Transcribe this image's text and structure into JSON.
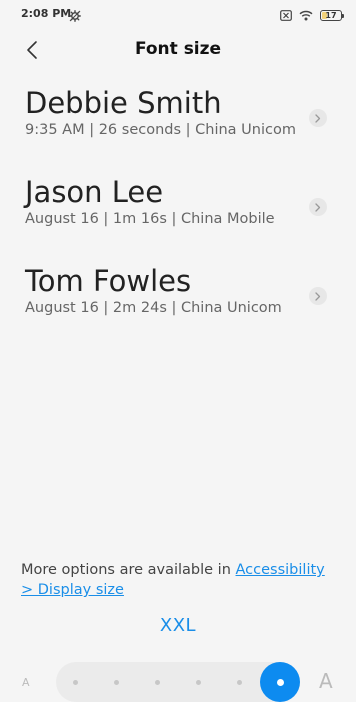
{
  "status_bar": {
    "time": "2:08 PM",
    "battery": "17",
    "icons": [
      "settings-icon",
      "sim-x-icon",
      "wifi-icon",
      "battery-icon"
    ]
  },
  "header": {
    "title": "Font size",
    "back_icon": "chevron-left-icon"
  },
  "call_log": [
    {
      "name": "Debbie Smith",
      "detail": "9:35 AM | 26 seconds | China Unicom"
    },
    {
      "name": "Jason Lee",
      "detail": "August 16 | 1m 16s | China Mobile"
    },
    {
      "name": "Tom Fowles",
      "detail": "August 16 | 2m 24s | China Unicom"
    }
  ],
  "footer": {
    "note_text": "More options are available in ",
    "link_text": "Accessibility > Display size"
  },
  "font_size": {
    "current_label": "XXL",
    "small_indicator": "A",
    "large_indicator": "A",
    "steps": 6,
    "selected_step": 6
  },
  "colors": {
    "accent": "#1a8ee8",
    "background": "#f5f5f5"
  }
}
